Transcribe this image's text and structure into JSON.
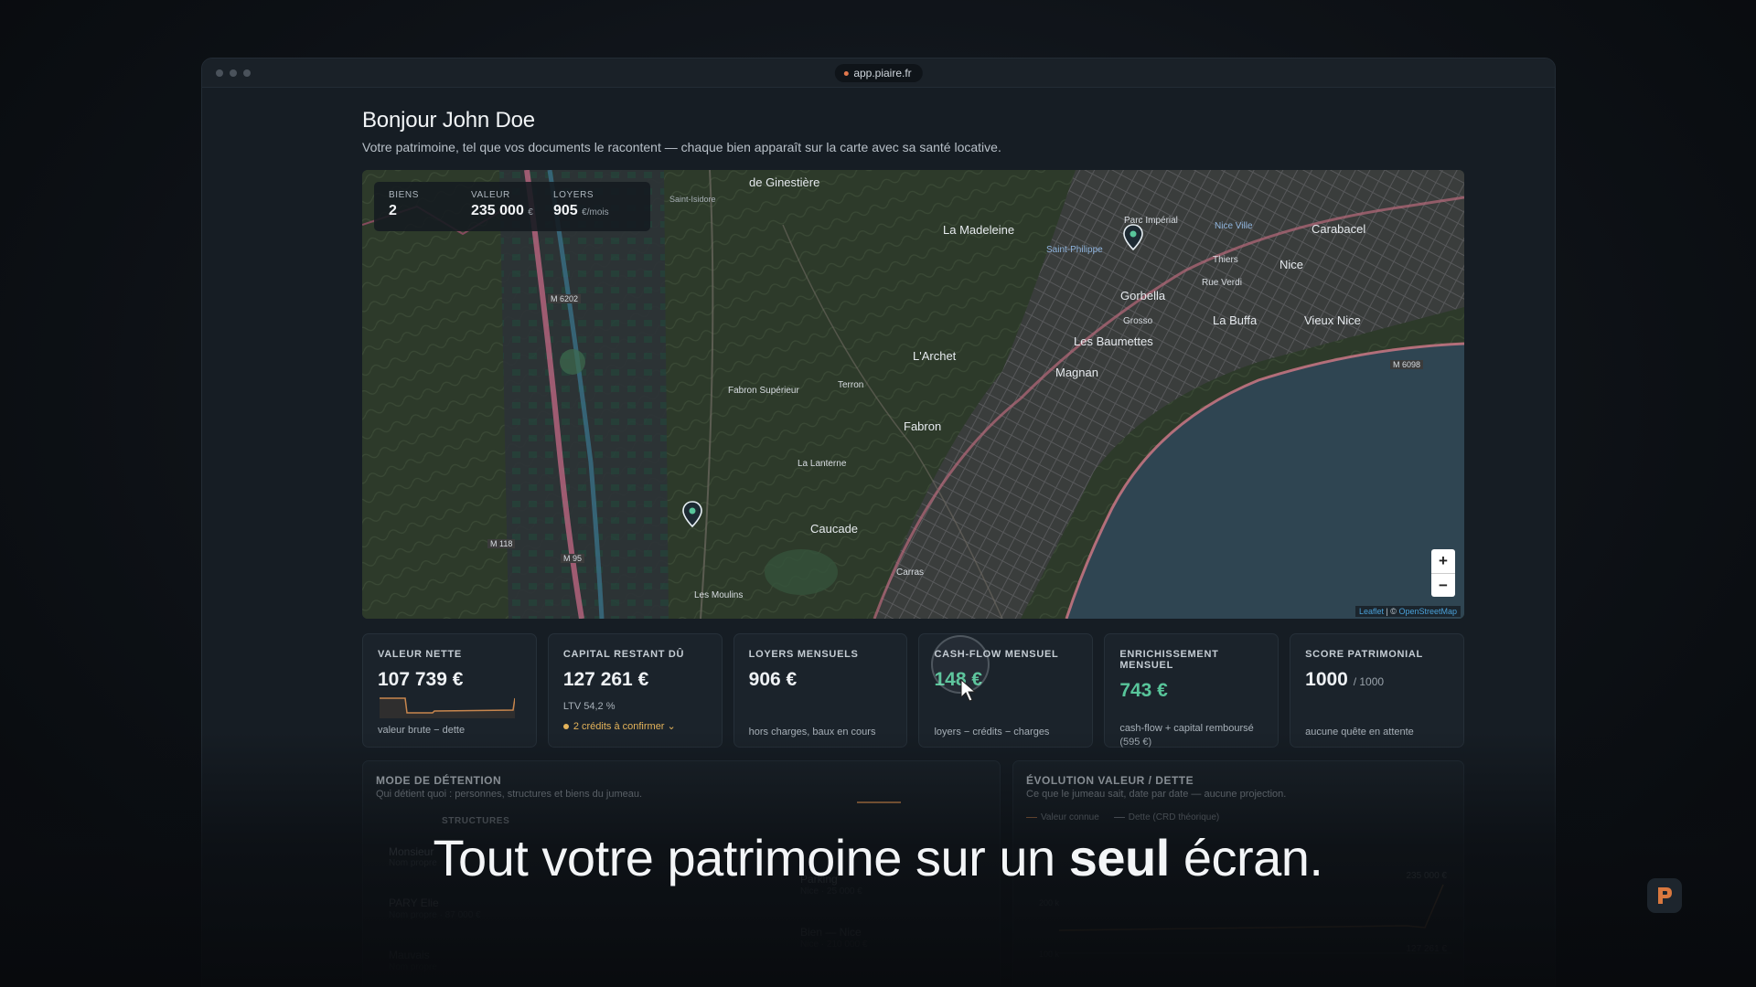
{
  "window": {
    "url": "app.piaire.fr"
  },
  "header": {
    "title": "Bonjour John Doe",
    "subtitle": "Votre patrimoine, tel que vos documents le racontent — chaque bien apparaît sur la carte avec sa santé locative."
  },
  "map": {
    "stats": [
      {
        "label": "BIENS",
        "value": "2",
        "unit": ""
      },
      {
        "label": "VALEUR",
        "value": "235 000",
        "unit": "€"
      },
      {
        "label": "LOYERS",
        "value": "905",
        "unit": "€/mois"
      }
    ],
    "labels": [
      "de Ginestière",
      "La Madeleine",
      "Saint-Philippe",
      "Parc Impérial",
      "Nice Ville",
      "Carabacel",
      "Nice",
      "Thiers",
      "Rue Verdi",
      "Gorbella",
      "Grosso",
      "La Buffa",
      "Vieux Nice",
      "Les Baumettes",
      "L'Archet",
      "Magnan",
      "Fabron Supérieur",
      "Terron",
      "Fabron",
      "La Lanterne",
      "Caucade",
      "Carras",
      "Les Moulins",
      "M 6202",
      "M 6098",
      "M 118",
      "M 95",
      "Saint-Isidore"
    ],
    "zoom_in": "+",
    "zoom_out": "−",
    "attribution_leaflet": "Leaflet",
    "attribution_sep": " | © ",
    "attribution_osm": "OpenStreetMap"
  },
  "kpis": [
    {
      "label": "VALEUR NETTE",
      "value": "107 739 €",
      "sub": "valeur brute − dette"
    },
    {
      "label": "CAPITAL RESTANT DÛ",
      "value": "127 261 €",
      "sub": "LTV 54,2 %",
      "warn": "2 crédits à confirmer ⌄"
    },
    {
      "label": "LOYERS MENSUELS",
      "value": "906 €",
      "sub": "hors charges, baux en cours"
    },
    {
      "label": "CASH-FLOW MENSUEL",
      "value": "148 €",
      "sub": "loyers − crédits − charges"
    },
    {
      "label": "ENRICHISSEMENT MENSUEL",
      "value": "743 €",
      "sub": "cash-flow + capital remboursé (595 €)"
    },
    {
      "label": "SCORE PATRIMONIAL",
      "value": "1000",
      "unit": "/ 1000",
      "sub": "aucune quête en attente"
    }
  ],
  "panels": {
    "detention": {
      "title": "MODE DE DÉTENTION",
      "subtitle": "Qui détient quoi : personnes, structures et biens du jumeau.",
      "structures_label": "STRUCTURES",
      "rows": [
        "Monsieur",
        "PARY Elie",
        "Mauvais"
      ],
      "row_subs": [
        "Nom propre",
        "Nom propre · 87 000 €",
        "Nom propre"
      ],
      "biens": [
        "Parking",
        "Bien — Nice"
      ],
      "bien_subs": [
        "Nice · 25 000 €",
        "Nice · 210 000 €"
      ]
    },
    "evolution": {
      "title": "ÉVOLUTION VALEUR / DETTE",
      "subtitle": "Ce que le jumeau sait, date par date — aucune projection.",
      "legend_value": "Valeur connue",
      "legend_debt": "Dette (CRD théorique)",
      "label_top": "235 000 €",
      "label_bottom": "127 261 €",
      "axis_1": "200 k",
      "axis_2": "100 k"
    }
  },
  "caption": {
    "before": "Tout votre patrimoine sur un ",
    "bold": "seul",
    "after": " écran."
  },
  "colors": {
    "accent_green": "#58c59a",
    "warning": "#e4b35a",
    "sea": "#2f4552"
  }
}
